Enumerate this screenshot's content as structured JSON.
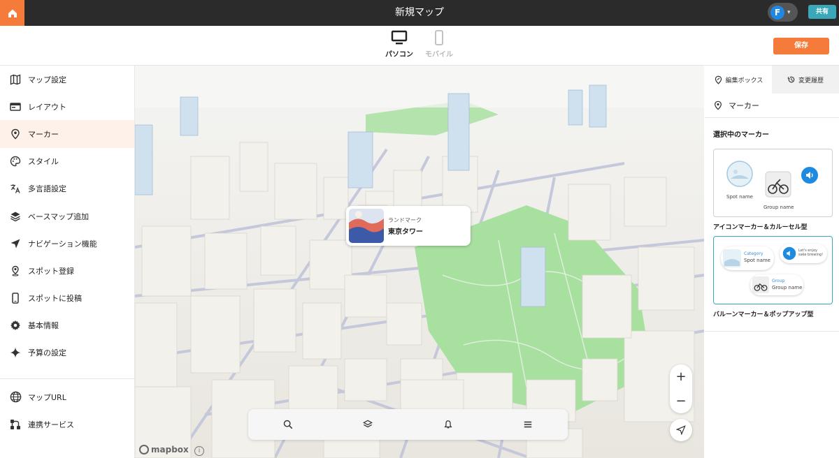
{
  "app": {
    "title": "新規マップ"
  },
  "header": {
    "avatar_initial": "F",
    "share_label": "共有",
    "save_label": "保存"
  },
  "device_tabs": [
    {
      "label": "パソコン",
      "active": true
    },
    {
      "label": "モバイル",
      "active": false
    }
  ],
  "sidebar": {
    "items": [
      {
        "label": "マップ設定",
        "icon": "map-icon"
      },
      {
        "label": "レイアウト",
        "icon": "layout-icon"
      },
      {
        "label": "マーカー",
        "icon": "marker-pin-icon",
        "active": true
      },
      {
        "label": "スタイル",
        "icon": "palette-icon"
      },
      {
        "label": "多言語設定",
        "icon": "translate-icon"
      },
      {
        "label": "ベースマップ追加",
        "icon": "layers-icon"
      },
      {
        "label": "ナビゲーション機能",
        "icon": "navigation-arrow-icon"
      },
      {
        "label": "スポット登録",
        "icon": "spot-pin-icon"
      },
      {
        "label": "スポットに投稿",
        "icon": "phone-icon"
      },
      {
        "label": "基本情報",
        "icon": "gear-icon"
      },
      {
        "label": "予算の設定",
        "icon": "sparkle-icon"
      }
    ],
    "bottom_items": [
      {
        "label": "マップURL",
        "icon": "globe-icon"
      },
      {
        "label": "連携サービス",
        "icon": "integration-icon"
      }
    ]
  },
  "map": {
    "popup": {
      "category": "ランドマーク",
      "name": "東京タワー"
    },
    "zoom_in": "+",
    "zoom_out": "−",
    "attribution": "mapbox",
    "info": "i"
  },
  "right_panel": {
    "tabs": [
      {
        "label": "編集ボックス",
        "icon": "edit-pin-icon",
        "active": true
      },
      {
        "label": "変更履歴",
        "icon": "history-icon",
        "active": false
      }
    ],
    "section_title": "マーカー",
    "selected_title": "選択中のマーカー",
    "card1": {
      "spot_label": "Spot name",
      "group_label": "Group name",
      "caption": "アイコンマーカー＆カルーセル型"
    },
    "card2": {
      "category": "Category",
      "spot_label": "Spot name",
      "balloon_text": "Let's enjoy sake brewing!",
      "group_small": "Group",
      "group_label": "Group name",
      "caption": "バルーンマーカー＆ポップアップ型"
    }
  },
  "colors": {
    "accent": "#f47b3a",
    "teal": "#3aa8b8",
    "topbar": "#2b2b2b",
    "park": "#a8e0a0"
  }
}
